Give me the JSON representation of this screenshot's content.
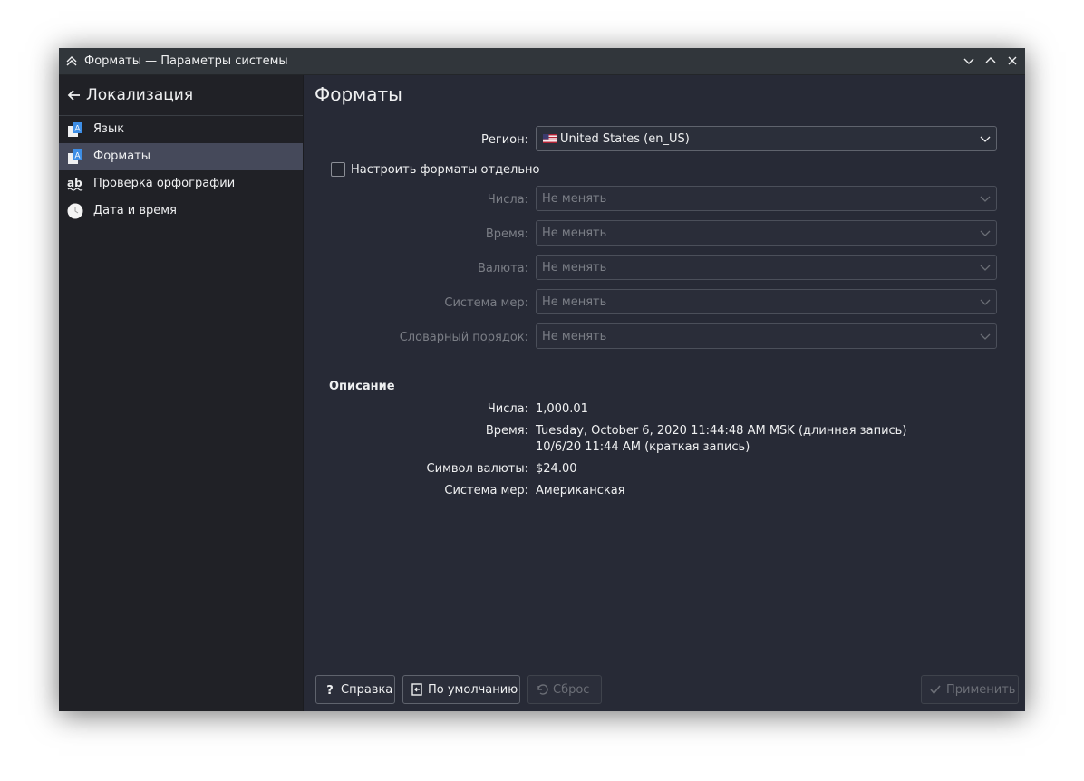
{
  "window": {
    "title": "Форматы — Параметры системы"
  },
  "sidebar": {
    "header": "Локализация",
    "items": [
      {
        "label": "Язык",
        "icon": "language-icon",
        "selected": false
      },
      {
        "label": "Форматы",
        "icon": "formats-icon",
        "selected": true
      },
      {
        "label": "Проверка орфографии",
        "icon": "spellcheck-icon",
        "selected": false
      },
      {
        "label": "Дата и время",
        "icon": "clock-icon",
        "selected": false
      }
    ]
  },
  "main": {
    "title": "Форматы",
    "region": {
      "label": "Регион:",
      "value": "United States (en_US)",
      "flag_icon": "us-flag-icon"
    },
    "custom_checkbox": {
      "label": "Настроить форматы отдельно",
      "checked": false
    },
    "fields": [
      {
        "label": "Числа:",
        "value": "Не менять"
      },
      {
        "label": "Время:",
        "value": "Не менять"
      },
      {
        "label": "Валюта:",
        "value": "Не менять"
      },
      {
        "label": "Система мер:",
        "value": "Не менять"
      },
      {
        "label": "Словарный порядок:",
        "value": "Не менять"
      }
    ],
    "description": {
      "title": "Описание",
      "numbers": {
        "label": "Числа:",
        "value": "1,000.01"
      },
      "time": {
        "label": "Время:",
        "long": "Tuesday, October 6, 2020 11:44:48 AM MSK (длинная запись)",
        "short": "10/6/20 11:44 AM (краткая запись)"
      },
      "currency": {
        "label": "Символ валюты:",
        "value": "$24.00"
      },
      "measurement": {
        "label": "Система мер:",
        "value": "Американская"
      }
    }
  },
  "buttons": {
    "help": "Справка",
    "defaults": "По умолчанию",
    "reset": "Сброс",
    "apply": "Применить"
  },
  "colors": {
    "selection": "#45495a",
    "sidebar": "#202126",
    "content": "#272a36"
  }
}
